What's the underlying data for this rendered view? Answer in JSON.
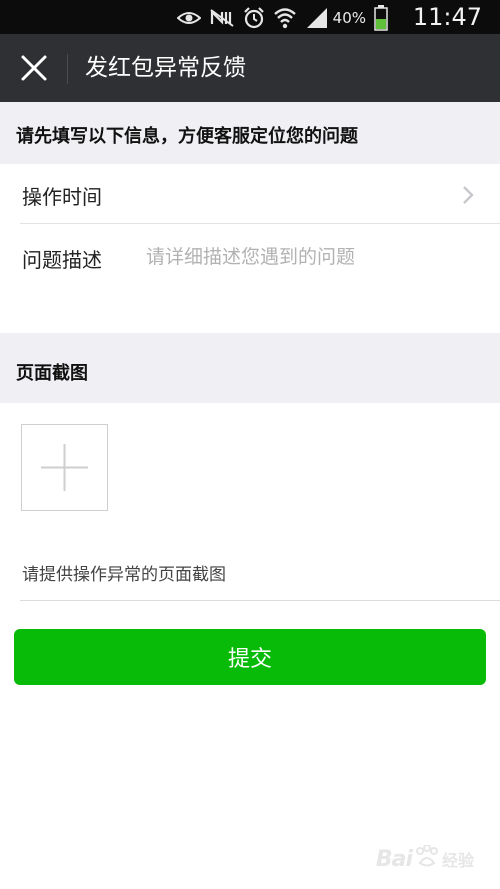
{
  "status_bar": {
    "battery_percent": "40%",
    "time": "11:47",
    "icons": [
      "eye-icon",
      "nfc-icon",
      "alarm-icon",
      "wifi-icon",
      "signal-icon",
      "battery-icon"
    ]
  },
  "header": {
    "title": "发红包异常反馈",
    "close_icon": "close-icon"
  },
  "info_section": {
    "heading": "请先填写以下信息，方便客服定位您的问题",
    "time_row": {
      "label": "操作时间",
      "icon": "chevron-right-icon"
    },
    "desc_row": {
      "label": "问题描述",
      "value": "",
      "placeholder": "请详细描述您遇到的问题"
    }
  },
  "screenshot_section": {
    "heading": "页面截图",
    "add_icon": "plus-icon",
    "hint": "请提供操作异常的页面截图"
  },
  "submit": {
    "label": "提交",
    "color": "#08bb08"
  },
  "watermark": {
    "text": "Bai",
    "sub": "经验"
  }
}
